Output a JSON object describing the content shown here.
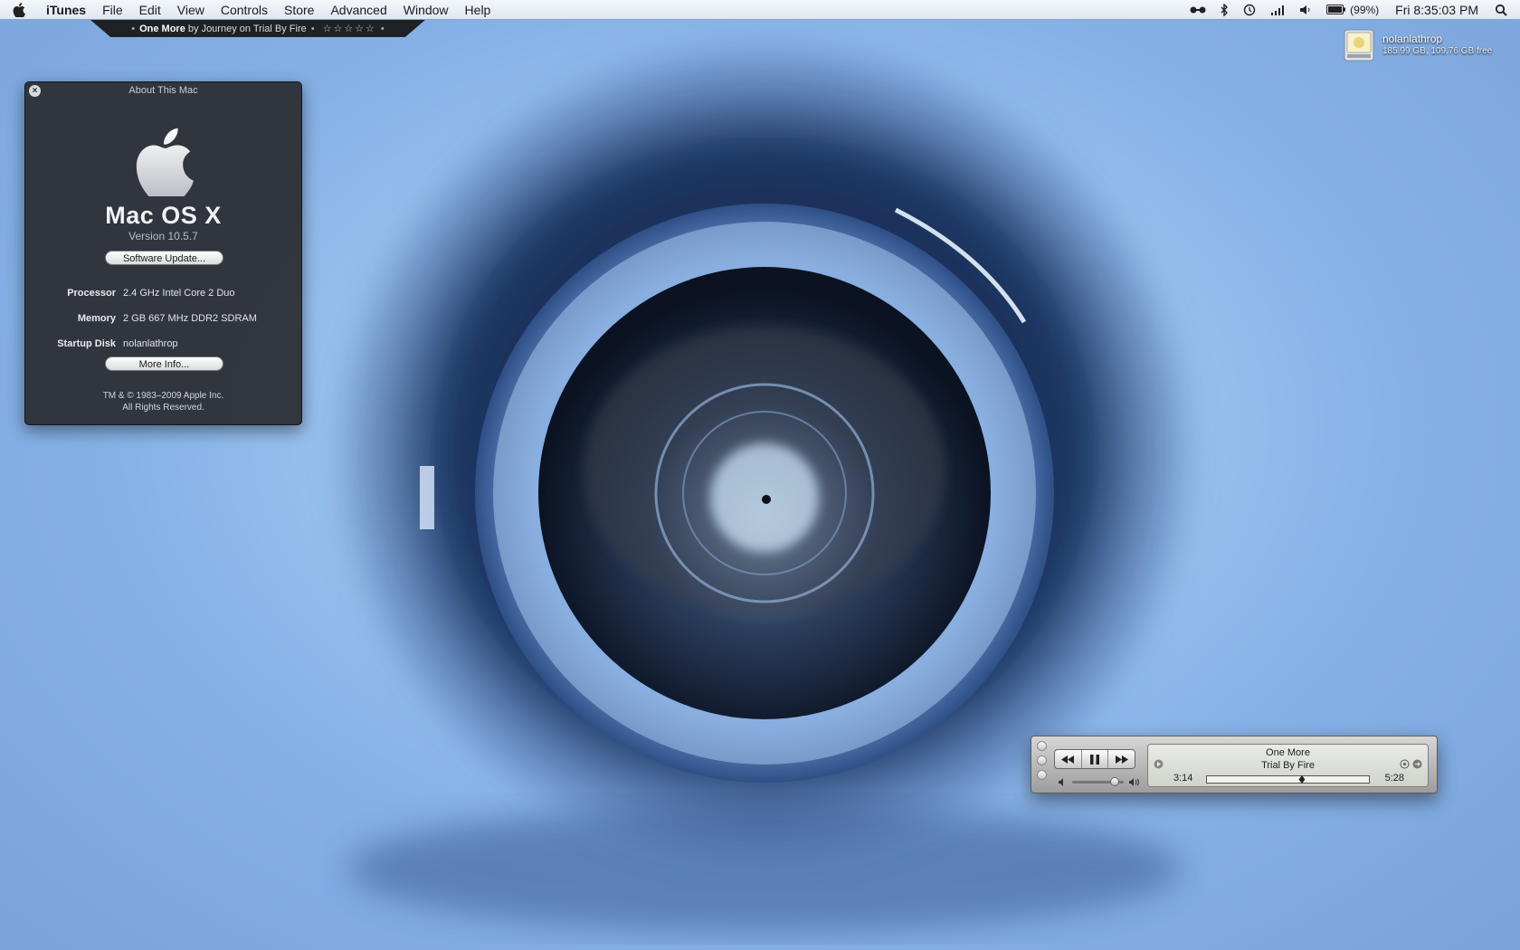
{
  "menubar": {
    "app_name": "iTunes",
    "items": [
      "File",
      "Edit",
      "View",
      "Controls",
      "Store",
      "Advanced",
      "Window",
      "Help"
    ],
    "battery_percent": "(99%)",
    "clock": "Fri 8:35:03 PM",
    "status_icons": [
      "airport-remote-icon",
      "bluetooth-icon",
      "time-machine-icon",
      "wifi-signal-icon",
      "volume-icon",
      "battery-icon",
      "spotlight-icon"
    ]
  },
  "now_playing": {
    "song": "One More",
    "by_text": "by Journey on Trial By Fire",
    "rating": "☆☆☆☆☆"
  },
  "desktop_drive": {
    "name": "nolanlathrop",
    "info": "185.99 GB, 109.76 GB free"
  },
  "about": {
    "title": "About This Mac",
    "os_name": "Mac OS X",
    "version": "Version 10.5.7",
    "software_update_label": "Software Update...",
    "processor_label": "Processor",
    "processor_value": "2.4 GHz Intel Core 2 Duo",
    "memory_label": "Memory",
    "memory_value": "2 GB 667 MHz DDR2 SDRAM",
    "startup_label": "Startup Disk",
    "startup_value": "nolanlathrop",
    "more_info_label": "More Info...",
    "legal_line1": "TM & © 1983–2009 Apple Inc.",
    "legal_line2": "All Rights Reserved."
  },
  "mini_player": {
    "song": "One More",
    "album": "Trial By Fire",
    "elapsed": "3:14",
    "total": "5:28",
    "progress_fraction": 0.59,
    "volume_fraction": 0.9
  }
}
